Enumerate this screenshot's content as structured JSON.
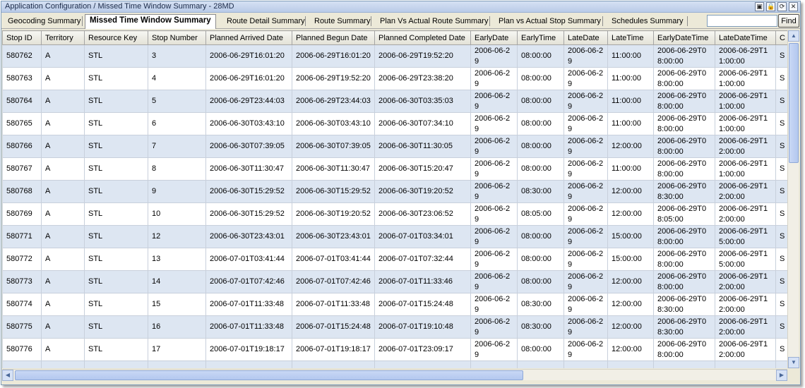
{
  "window": {
    "title": "Application Configuration / Missed Time Window Summary - 28MD",
    "controls": [
      "▣",
      "🔒",
      "⟳",
      "✕"
    ]
  },
  "tabs": [
    {
      "label": "Geocoding Summary",
      "active": false
    },
    {
      "label": "Missed Time Window Summary",
      "active": true
    },
    {
      "label": "Route Detail Summary",
      "active": false
    },
    {
      "label": "Route Summary",
      "active": false
    },
    {
      "label": "Plan Vs Actual Route Summary",
      "active": false
    },
    {
      "label": "Plan vs Actual Stop Summary",
      "active": false
    },
    {
      "label": "Schedules Summary",
      "active": false
    }
  ],
  "find": {
    "value": "",
    "button_label": "Find"
  },
  "table": {
    "columns": [
      "Stop ID",
      "Territory",
      "Resource Key",
      "Stop Number",
      "Planned Arrived Date",
      "Planned Begun Date",
      "Planned Completed Date",
      "EarlyDate",
      "EarlyTime",
      "LateDate",
      "LateTime",
      "EarlyDateTime",
      "LateDateTime",
      "C"
    ],
    "rows": [
      [
        "580762",
        "A",
        "STL",
        "3",
        "2006-06-29T16:01:20",
        "2006-06-29T16:01:20",
        "2006-06-29T19:52:20",
        "2006-06-29",
        "08:00:00",
        "2006-06-29",
        "11:00:00",
        "2006-06-29T08:00:00",
        "2006-06-29T11:00:00",
        "S"
      ],
      [
        "580763",
        "A",
        "STL",
        "4",
        "2006-06-29T16:01:20",
        "2006-06-29T19:52:20",
        "2006-06-29T23:38:20",
        "2006-06-29",
        "08:00:00",
        "2006-06-29",
        "11:00:00",
        "2006-06-29T08:00:00",
        "2006-06-29T11:00:00",
        "S"
      ],
      [
        "580764",
        "A",
        "STL",
        "5",
        "2006-06-29T23:44:03",
        "2006-06-29T23:44:03",
        "2006-06-30T03:35:03",
        "2006-06-29",
        "08:00:00",
        "2006-06-29",
        "11:00:00",
        "2006-06-29T08:00:00",
        "2006-06-29T11:00:00",
        "S"
      ],
      [
        "580765",
        "A",
        "STL",
        "6",
        "2006-06-30T03:43:10",
        "2006-06-30T03:43:10",
        "2006-06-30T07:34:10",
        "2006-06-29",
        "08:00:00",
        "2006-06-29",
        "11:00:00",
        "2006-06-29T08:00:00",
        "2006-06-29T11:00:00",
        "S"
      ],
      [
        "580766",
        "A",
        "STL",
        "7",
        "2006-06-30T07:39:05",
        "2006-06-30T07:39:05",
        "2006-06-30T11:30:05",
        "2006-06-29",
        "08:00:00",
        "2006-06-29",
        "12:00:00",
        "2006-06-29T08:00:00",
        "2006-06-29T12:00:00",
        "S"
      ],
      [
        "580767",
        "A",
        "STL",
        "8",
        "2006-06-30T11:30:47",
        "2006-06-30T11:30:47",
        "2006-06-30T15:20:47",
        "2006-06-29",
        "08:00:00",
        "2006-06-29",
        "11:00:00",
        "2006-06-29T08:00:00",
        "2006-06-29T11:00:00",
        "S"
      ],
      [
        "580768",
        "A",
        "STL",
        "9",
        "2006-06-30T15:29:52",
        "2006-06-30T15:29:52",
        "2006-06-30T19:20:52",
        "2006-06-29",
        "08:30:00",
        "2006-06-29",
        "12:00:00",
        "2006-06-29T08:30:00",
        "2006-06-29T12:00:00",
        "S"
      ],
      [
        "580769",
        "A",
        "STL",
        "10",
        "2006-06-30T15:29:52",
        "2006-06-30T19:20:52",
        "2006-06-30T23:06:52",
        "2006-06-29",
        "08:05:00",
        "2006-06-29",
        "12:00:00",
        "2006-06-29T08:05:00",
        "2006-06-29T12:00:00",
        "S"
      ],
      [
        "580771",
        "A",
        "STL",
        "12",
        "2006-06-30T23:43:01",
        "2006-06-30T23:43:01",
        "2006-07-01T03:34:01",
        "2006-06-29",
        "08:00:00",
        "2006-06-29",
        "15:00:00",
        "2006-06-29T08:00:00",
        "2006-06-29T15:00:00",
        "S"
      ],
      [
        "580772",
        "A",
        "STL",
        "13",
        "2006-07-01T03:41:44",
        "2006-07-01T03:41:44",
        "2006-07-01T07:32:44",
        "2006-06-29",
        "08:00:00",
        "2006-06-29",
        "15:00:00",
        "2006-06-29T08:00:00",
        "2006-06-29T15:00:00",
        "S"
      ],
      [
        "580773",
        "A",
        "STL",
        "14",
        "2006-07-01T07:42:46",
        "2006-07-01T07:42:46",
        "2006-07-01T11:33:46",
        "2006-06-29",
        "08:00:00",
        "2006-06-29",
        "12:00:00",
        "2006-06-29T08:00:00",
        "2006-06-29T12:00:00",
        "S"
      ],
      [
        "580774",
        "A",
        "STL",
        "15",
        "2006-07-01T11:33:48",
        "2006-07-01T11:33:48",
        "2006-07-01T15:24:48",
        "2006-06-29",
        "08:30:00",
        "2006-06-29",
        "12:00:00",
        "2006-06-29T08:30:00",
        "2006-06-29T12:00:00",
        "S"
      ],
      [
        "580775",
        "A",
        "STL",
        "16",
        "2006-07-01T11:33:48",
        "2006-07-01T15:24:48",
        "2006-07-01T19:10:48",
        "2006-06-29",
        "08:30:00",
        "2006-06-29",
        "12:00:00",
        "2006-06-29T08:30:00",
        "2006-06-29T12:00:00",
        "S"
      ],
      [
        "580776",
        "A",
        "STL",
        "17",
        "2006-07-01T19:18:17",
        "2006-07-01T19:18:17",
        "2006-07-01T23:09:17",
        "2006-06-29",
        "08:00:00",
        "2006-06-29",
        "12:00:00",
        "2006-06-29T08:00:00",
        "2006-06-29T12:00:00",
        "S"
      ],
      [
        "",
        "",
        "",
        "",
        "",
        "2006-07-",
        "",
        "2006-06-",
        "",
        "2006-06-",
        "",
        "2006-06-",
        "2006-06-",
        ""
      ]
    ]
  },
  "scrollbars": {
    "up": "▲",
    "down": "▼",
    "left": "◀",
    "right": "▶"
  }
}
